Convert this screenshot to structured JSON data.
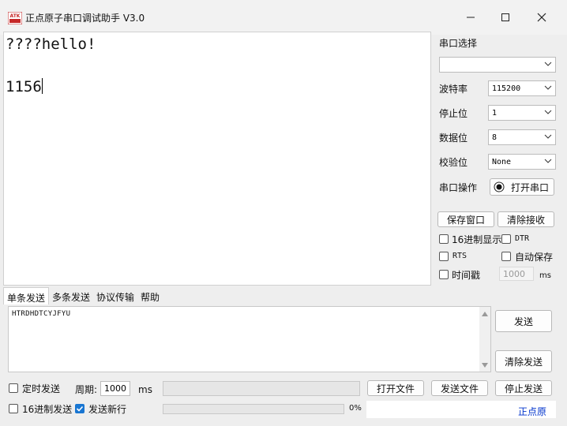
{
  "window": {
    "title": "正点原子串口调试助手 V3.0",
    "logo_text": "ATK"
  },
  "receive": {
    "line1": "????hello!",
    "line2": "1156"
  },
  "settings": {
    "port_label": "串口选择",
    "port_value": "",
    "baud_label": "波特率",
    "baud_value": "115200",
    "stop_label": "停止位",
    "stop_value": "1",
    "data_label": "数据位",
    "data_value": "8",
    "parity_label": "校验位",
    "parity_value": "None",
    "op_label": "串口操作",
    "open_port_button": "打开串口"
  },
  "buttons": {
    "save_window": "保存窗口",
    "clear_receive": "清除接收",
    "send": "发送",
    "clear_send": "清除发送",
    "open_file": "打开文件",
    "send_file": "发送文件",
    "stop_send": "停止发送"
  },
  "options": {
    "hex_display": "16进制显示",
    "dtr": "DTR",
    "rts": "RTS",
    "auto_save": "自动保存",
    "timestamp": "时间戳",
    "timestamp_value": "1000",
    "timestamp_unit": "ms"
  },
  "tabs": [
    {
      "label": "单条发送",
      "active": true
    },
    {
      "label": "多条发送",
      "active": false
    },
    {
      "label": "协议传输",
      "active": false
    },
    {
      "label": "帮助",
      "active": false
    }
  ],
  "send": {
    "text": "HTRDHDTCYJFYU",
    "timed_send_label": "定时发送",
    "period_label": "周期:",
    "period_value": "1000",
    "period_unit": "ms",
    "hex_send_label": "16进制发送",
    "send_newline_label": "发送新行",
    "send_newline_checked": true,
    "progress_percent": "0%",
    "progress_fraction": 0,
    "brand_link": "正点原"
  },
  "colors": {
    "accent": "#1976d2",
    "brand_link": "#0033cc"
  }
}
